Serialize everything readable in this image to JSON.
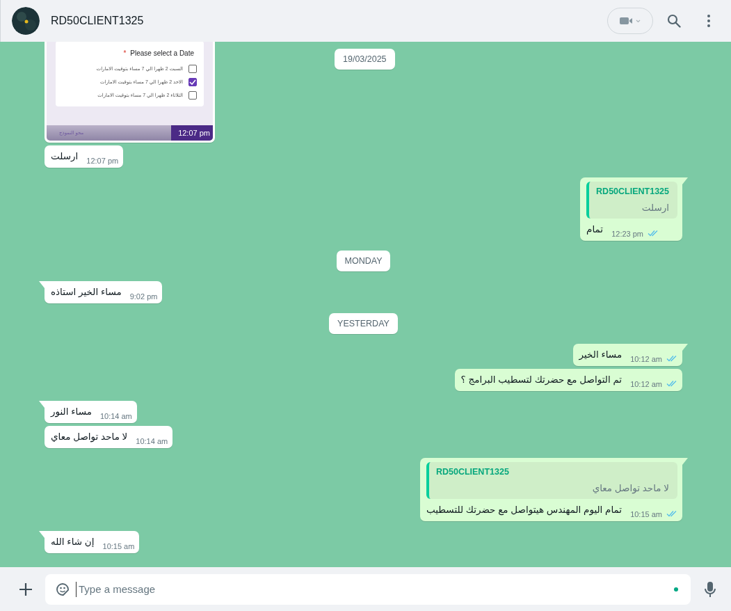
{
  "header": {
    "contact_name": "RD50CLIENT1325"
  },
  "chat": {
    "sticky_date": "19/03/2025",
    "messages": [
      {
        "kind": "image",
        "outgoing": false,
        "form": {
          "required_mark": "*",
          "question": "Please select a Date",
          "options": [
            {
              "label": "السبت 2 ظهرا الي 7 مساء بتوقيت الامارات",
              "checked": false
            },
            {
              "label": "الاحد 2 ظهرا الي 7 مساء بتوقيت الامارات",
              "checked": true
            },
            {
              "label": "الثلاثاء 2 ظهرا الي 7 مساء بتوقيت الامارات",
              "checked": false
            }
          ],
          "clear_link": "محو النموذج"
        },
        "time": "12:07 pm"
      },
      {
        "kind": "text",
        "outgoing": false,
        "text": "ارسلت",
        "time": "12:07 pm"
      },
      {
        "kind": "quote",
        "outgoing": true,
        "quote_author": "RD50CLIENT1325",
        "quote_text": "ارسلت",
        "text": "تمام",
        "time": "12:23 pm",
        "read": true
      },
      {
        "kind": "date",
        "label": "MONDAY"
      },
      {
        "kind": "text",
        "outgoing": false,
        "text": "مساء الخير استاذه",
        "time": "9:02 pm"
      },
      {
        "kind": "date",
        "label": "YESTERDAY"
      },
      {
        "kind": "text",
        "outgoing": true,
        "text": "مساء الخير",
        "time": "10:12 am",
        "read": true
      },
      {
        "kind": "text",
        "outgoing": true,
        "text": "تم التواصل مع حضرتك لتسطيب البرامج ؟",
        "time": "10:12 am",
        "read": true
      },
      {
        "kind": "text",
        "outgoing": false,
        "text": "مساء النور",
        "time": "10:14 am"
      },
      {
        "kind": "text",
        "outgoing": false,
        "text": "لا  ماحد تواصل معاي",
        "time": "10:14 am"
      },
      {
        "kind": "quote",
        "outgoing": true,
        "quote_author": "RD50CLIENT1325",
        "quote_text": "لا  ماحد تواصل معاي",
        "text": "تمام اليوم المهندس هيتواصل مع حضرتك للتسطيب",
        "time": "10:15 am",
        "read": true
      },
      {
        "kind": "text",
        "outgoing": false,
        "text": "إن شاء الله",
        "time": "10:15 am"
      }
    ]
  },
  "composer": {
    "placeholder": "Type a message"
  }
}
